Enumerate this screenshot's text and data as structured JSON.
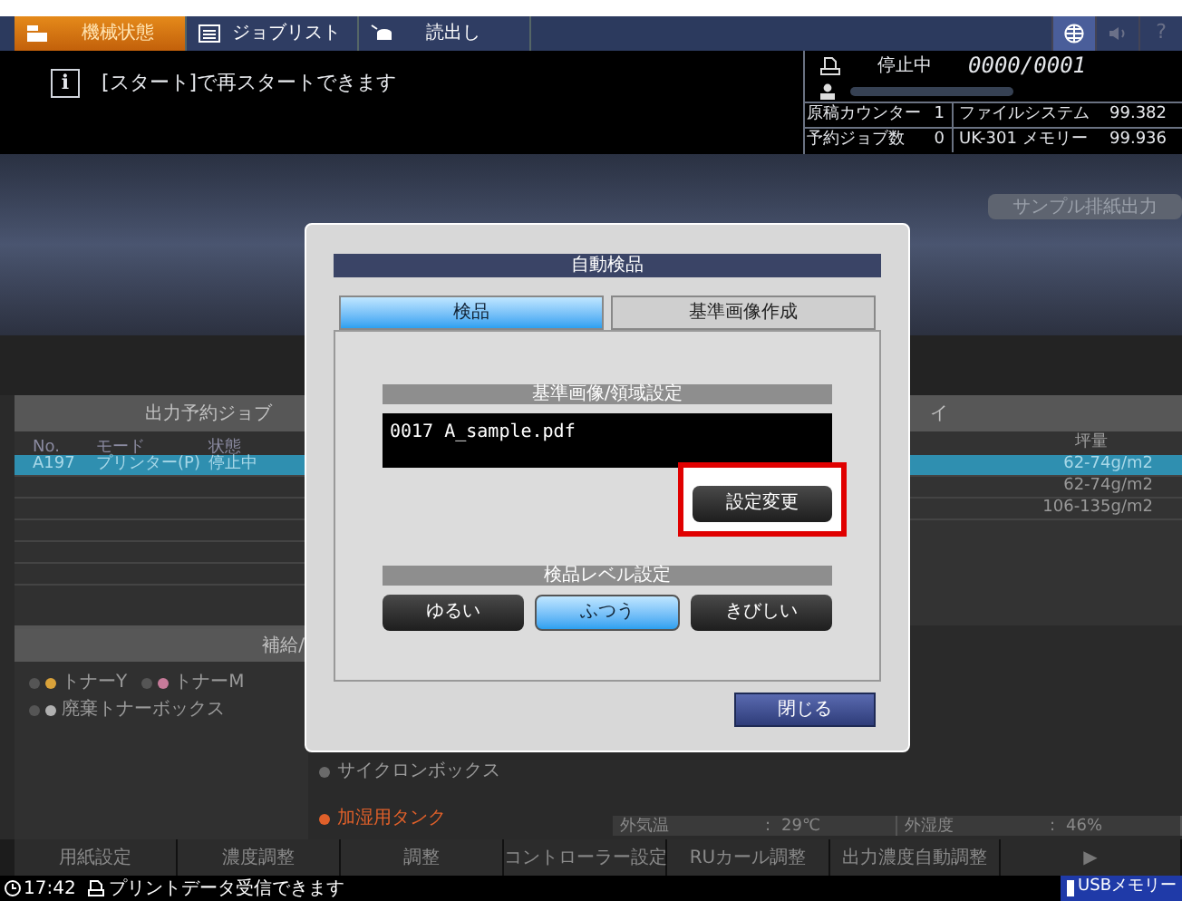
{
  "top_tabs": [
    {
      "label": "機械状態",
      "kind": "machine",
      "selected": true
    },
    {
      "label": "ジョブリスト",
      "kind": "list",
      "selected": false
    },
    {
      "label": "読出し",
      "kind": "read",
      "selected": false
    }
  ],
  "top_icons": [
    {
      "kind": "globe",
      "selected": true
    },
    {
      "kind": "speaker",
      "selected": false
    },
    {
      "kind": "help",
      "label": "?",
      "selected": false
    }
  ],
  "info_icon": "i",
  "message": "[スタート]で再スタートできます",
  "status": {
    "state": "停止中",
    "count": "0000/0001",
    "rows": [
      [
        "原稿カウンター",
        "1",
        "ファイルシステム",
        "99.382"
      ],
      [
        "予約ジョブ数",
        "0",
        "UK-301 メモリー",
        "99.936"
      ]
    ]
  },
  "sample_button": "サンプル排紙出力",
  "job_panel": {
    "title": "出力予約ジョブ",
    "columns": [
      "No.",
      "モード",
      "状態"
    ],
    "rows": [
      {
        "cells": [
          "A197",
          "プリンター(P)",
          "停止中"
        ],
        "selected": true
      }
    ]
  },
  "paper_panel": {
    "title": "イ",
    "column": "坪量",
    "rows": [
      {
        "weight": "62-74g/m2",
        "selected": true
      },
      {
        "weight": "62-74g/m2",
        "selected": false
      },
      {
        "weight": "106-135g/m2",
        "selected": false
      }
    ]
  },
  "supply_panel": {
    "title": "補給/",
    "items": [
      {
        "label": "トナーY",
        "color": "#d9a23a"
      },
      {
        "label": "トナーM",
        "color": "#c77b9a"
      },
      {
        "label": "廃棄トナーボックス",
        "color": "#b0b0b0"
      }
    ]
  },
  "other_supplies": [
    {
      "label": "サイクロンボックス",
      "color": "#6a6a6a"
    },
    {
      "label": "加湿用タンク",
      "color": "#e0602a"
    }
  ],
  "environment": [
    {
      "label": "外気温",
      "separator": ":",
      "value": "29℃"
    },
    {
      "label": "外湿度",
      "separator": ":",
      "value": "46%"
    }
  ],
  "bottom_buttons": [
    "用紙設定",
    "濃度調整",
    "調整",
    "コントローラー設定",
    "RUカール調整",
    "出力濃度自動調整",
    "▶"
  ],
  "status_bar": {
    "time": "17:42",
    "message": "プリントデータ受信できます",
    "usb": "USBメモリー"
  },
  "dialog": {
    "title": "自動検品",
    "tabs": [
      {
        "label": "検品",
        "selected": true
      },
      {
        "label": "基準画像作成",
        "selected": false
      }
    ],
    "image_section": "基準画像/領域設定",
    "file": "0017 A_sample.pdf",
    "change_button": "設定変更",
    "level_section": "検品レベル設定",
    "levels": [
      {
        "label": "ゆるい",
        "selected": false
      },
      {
        "label": "ふつう",
        "selected": true
      },
      {
        "label": "きびしい",
        "selected": false
      }
    ],
    "close_button": "閉じる"
  }
}
